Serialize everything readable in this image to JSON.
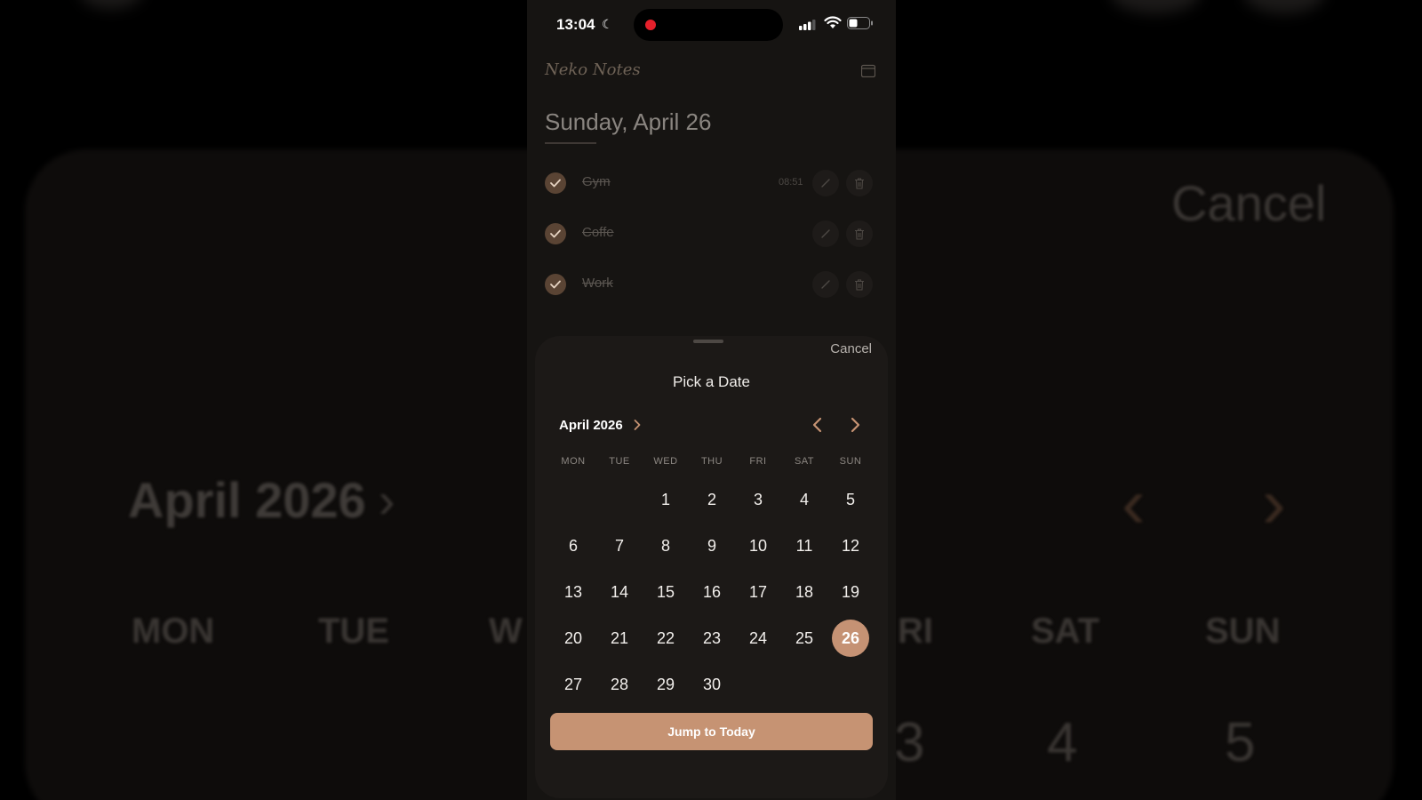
{
  "background": {
    "cancel": "Cancel",
    "month": "April 2026",
    "weekdays": [
      "MON",
      "TUE",
      "W",
      "RI",
      "SAT",
      "SUN"
    ],
    "numbers": [
      "3",
      "4",
      "5"
    ]
  },
  "status_bar": {
    "time": "13:04",
    "recording": true
  },
  "app": {
    "title": "Neko Notes",
    "date_heading": "Sunday, April 26"
  },
  "tasks": [
    {
      "label": "Gym",
      "time": "08:51",
      "done": true
    },
    {
      "label": "Coffe",
      "time": "",
      "done": true
    },
    {
      "label": "Work",
      "time": "",
      "done": true
    }
  ],
  "picker": {
    "cancel_label": "Cancel",
    "title": "Pick a Date",
    "month_label": "April 2026",
    "weekdays": [
      "MON",
      "TUE",
      "WED",
      "THU",
      "FRI",
      "SAT",
      "SUN"
    ],
    "weeks": [
      [
        "",
        "",
        "1",
        "2",
        "3",
        "4",
        "5"
      ],
      [
        "6",
        "7",
        "8",
        "9",
        "10",
        "11",
        "12"
      ],
      [
        "13",
        "14",
        "15",
        "16",
        "17",
        "18",
        "19"
      ],
      [
        "20",
        "21",
        "22",
        "23",
        "24",
        "25",
        "26"
      ],
      [
        "27",
        "28",
        "29",
        "30",
        "",
        "",
        ""
      ]
    ],
    "selected_day": "26",
    "jump_label": "Jump to Today"
  },
  "colors": {
    "accent": "#c69373",
    "background": "#161412",
    "sheet": "#1c1917"
  }
}
